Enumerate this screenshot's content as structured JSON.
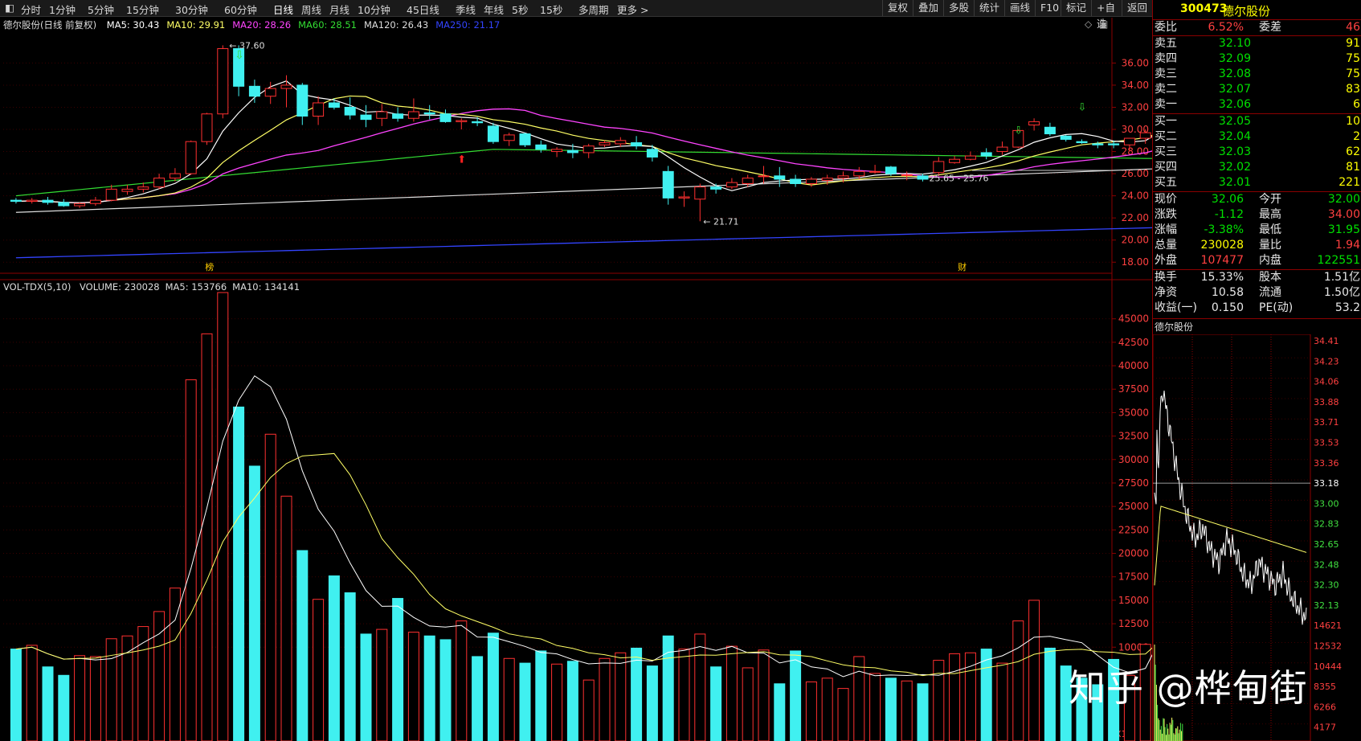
{
  "toolbar": {
    "periods": [
      "分时",
      "1分钟",
      "5分钟",
      "15分钟",
      "30分钟",
      "60分钟",
      "日线",
      "周线",
      "月线",
      "10分钟",
      "45日线",
      "季线",
      "年线",
      "5秒",
      "15秒",
      "多周期",
      "更多 >"
    ],
    "active": "日线",
    "right_buttons": [
      "复权",
      "叠加",
      "多股",
      "统计",
      "画线",
      "F10",
      "标记",
      "+自选",
      "返回"
    ]
  },
  "kline_legend": {
    "name": "德尔股份(日线 前复权)",
    "items": [
      {
        "label": "MA5: 30.43",
        "color": "#ffffff"
      },
      {
        "label": "MA10: 29.91",
        "color": "#ffff66"
      },
      {
        "label": "MA20: 28.26",
        "color": "#ff44ff"
      },
      {
        "label": "MA60: 28.51",
        "color": "#33dd33"
      },
      {
        "label": "MA120: 26.43",
        "color": "#dddddd"
      },
      {
        "label": "MA250: 21.17",
        "color": "#3344ff"
      }
    ]
  },
  "price_axis": [
    "36.00",
    "34.00",
    "32.00",
    "30.00",
    "28.00",
    "26.00",
    "24.00",
    "22.00",
    "20.00",
    "18.00"
  ],
  "annotations": {
    "high": "37.60",
    "low": "21.71",
    "range": "25.65 - 25.76",
    "event1": "榜",
    "event2": "财"
  },
  "vol_legend": {
    "name": "VOL-TDX(5,10)",
    "items": [
      {
        "label": "VOLUME: 230028",
        "color": "#dddddd"
      },
      {
        "label": "MA5: 153766",
        "color": "#dddddd"
      },
      {
        "label": "MA10: 134141",
        "color": "#dddddd"
      }
    ]
  },
  "vol_axis": [
    "45000",
    "42500",
    "40000",
    "37500",
    "35000",
    "32500",
    "30000",
    "27500",
    "25000",
    "22500",
    "20000",
    "17500",
    "15000",
    "12500",
    "10000"
  ],
  "vol_axis_unit": "X10",
  "chart_data": {
    "type": "candlestick",
    "ylim": [
      17,
      38.5
    ],
    "candles": [
      [
        23.6,
        23.8,
        23.3,
        23.5
      ],
      [
        23.5,
        23.8,
        23.3,
        23.6
      ],
      [
        23.6,
        23.9,
        23.2,
        23.4
      ],
      [
        23.4,
        23.7,
        23.0,
        23.1
      ],
      [
        23.1,
        23.4,
        22.9,
        23.3
      ],
      [
        23.3,
        23.9,
        23.1,
        23.6
      ],
      [
        23.6,
        25.0,
        23.5,
        24.6
      ],
      [
        24.4,
        25.0,
        24.1,
        24.6
      ],
      [
        24.6,
        25.2,
        24.3,
        24.8
      ],
      [
        24.8,
        26.0,
        24.6,
        25.6
      ],
      [
        25.6,
        26.5,
        25.3,
        26.0
      ],
      [
        26.0,
        29.0,
        25.9,
        28.9
      ],
      [
        28.9,
        31.5,
        28.6,
        31.4
      ],
      [
        31.4,
        37.6,
        31.0,
        37.3
      ],
      [
        37.3,
        37.6,
        33.0,
        33.9
      ],
      [
        33.9,
        34.5,
        32.4,
        33.0
      ],
      [
        33.0,
        34.3,
        32.3,
        33.7
      ],
      [
        33.7,
        34.9,
        32.0,
        34.0
      ],
      [
        34.0,
        34.2,
        30.4,
        31.2
      ],
      [
        31.2,
        33.0,
        30.4,
        32.4
      ],
      [
        32.4,
        32.8,
        31.8,
        32.0
      ],
      [
        32.0,
        32.9,
        30.9,
        31.3
      ],
      [
        31.3,
        32.2,
        30.2,
        30.9
      ],
      [
        31.0,
        32.3,
        30.3,
        31.6
      ],
      [
        31.4,
        32.0,
        30.7,
        31.0
      ],
      [
        31.0,
        32.8,
        30.7,
        31.6
      ],
      [
        31.5,
        32.2,
        30.9,
        31.4
      ],
      [
        31.4,
        31.8,
        30.6,
        30.7
      ],
      [
        30.7,
        31.0,
        30.0,
        30.8
      ],
      [
        30.7,
        31.1,
        30.3,
        30.6
      ],
      [
        30.3,
        30.6,
        28.7,
        28.9
      ],
      [
        29.0,
        29.7,
        28.5,
        29.5
      ],
      [
        29.6,
        29.7,
        28.4,
        28.6
      ],
      [
        28.6,
        29.0,
        27.9,
        28.2
      ],
      [
        28.0,
        28.4,
        27.5,
        28.2
      ],
      [
        28.1,
        28.7,
        27.4,
        27.9
      ],
      [
        27.9,
        28.7,
        27.4,
        28.5
      ],
      [
        28.6,
        29.0,
        28.4,
        28.8
      ],
      [
        28.7,
        29.3,
        28.4,
        29.0
      ],
      [
        28.8,
        29.4,
        28.2,
        28.5
      ],
      [
        28.2,
        28.6,
        27.1,
        27.5
      ],
      [
        26.2,
        26.7,
        23.2,
        23.8
      ],
      [
        23.8,
        24.4,
        23.0,
        23.9
      ],
      [
        23.7,
        25.1,
        21.7,
        24.8
      ],
      [
        24.8,
        25.1,
        24.2,
        24.6
      ],
      [
        24.8,
        25.6,
        24.6,
        25.2
      ],
      [
        25.1,
        25.9,
        24.8,
        25.6
      ],
      [
        25.8,
        26.7,
        25.1,
        25.8
      ],
      [
        25.8,
        26.6,
        24.8,
        25.5
      ],
      [
        25.5,
        25.9,
        24.8,
        25.1
      ],
      [
        25.1,
        25.7,
        24.8,
        25.5
      ],
      [
        25.4,
        25.9,
        25.0,
        25.6
      ],
      [
        25.6,
        26.2,
        25.2,
        25.8
      ],
      [
        25.8,
        26.6,
        25.5,
        26.2
      ],
      [
        26.2,
        26.8,
        26.0,
        26.2
      ],
      [
        26.6,
        26.7,
        25.8,
        26.0
      ],
      [
        25.9,
        26.2,
        25.4,
        25.9
      ],
      [
        25.8,
        26.0,
        25.3,
        25.5
      ],
      [
        26.1,
        27.5,
        25.8,
        27.1
      ],
      [
        27.0,
        27.6,
        26.9,
        27.3
      ],
      [
        27.3,
        28.0,
        27.2,
        27.6
      ],
      [
        27.9,
        28.3,
        27.3,
        27.6
      ],
      [
        28.0,
        28.9,
        27.7,
        28.4
      ],
      [
        28.4,
        30.0,
        28.3,
        29.9
      ],
      [
        30.4,
        31.0,
        29.9,
        30.7
      ],
      [
        30.2,
        30.6,
        29.4,
        29.6
      ],
      [
        29.4,
        29.5,
        28.9,
        29.1
      ],
      [
        28.9,
        29.1,
        28.7,
        28.8
      ],
      [
        28.7,
        28.9,
        28.3,
        28.6
      ],
      [
        28.7,
        29.0,
        28.3,
        28.6
      ],
      [
        28.6,
        29.0,
        28.1,
        29.2
      ],
      [
        29.2,
        30.0,
        28.7,
        29.7
      ],
      [
        29.7,
        35.6,
        29.6,
        33.2
      ],
      [
        33.2,
        34.0,
        31.9,
        32.1
      ]
    ],
    "volume": [
      9800,
      10200,
      7900,
      7000,
      9100,
      9000,
      10900,
      11200,
      12200,
      13800,
      16300,
      38500,
      43400,
      47800,
      35600,
      29300,
      32700,
      26100,
      20300,
      15100,
      17600,
      15800,
      11400,
      11900,
      15200,
      11600,
      11200,
      10800,
      12800,
      9000,
      11500,
      8800,
      8300,
      9600,
      8200,
      8500,
      6500,
      8800,
      9400,
      9900,
      8000,
      11200,
      9800,
      11400,
      7900,
      10100,
      7800,
      9700,
      6100,
      9600,
      6300,
      6700,
      5600,
      9000,
      7200,
      6700,
      6400,
      6100,
      8600,
      9300,
      9400,
      9800,
      8300,
      12800,
      15000,
      9900,
      8000,
      6700,
      6000,
      8700,
      7000,
      10300,
      23600,
      20100
    ],
    "vol_ylim": [
      0,
      47800
    ]
  },
  "right_panel": {
    "code": "300473",
    "name": "德尔股份",
    "weibi": {
      "label": "委比",
      "value": "6.52%",
      "label2": "委差",
      "value2": "46"
    },
    "sells": [
      {
        "label": "卖五",
        "price": "32.10",
        "vol": "91"
      },
      {
        "label": "卖四",
        "price": "32.09",
        "vol": "75"
      },
      {
        "label": "卖三",
        "price": "32.08",
        "vol": "75"
      },
      {
        "label": "卖二",
        "price": "32.07",
        "vol": "83"
      },
      {
        "label": "卖一",
        "price": "32.06",
        "vol": "6"
      }
    ],
    "buys": [
      {
        "label": "买一",
        "price": "32.05",
        "vol": "10"
      },
      {
        "label": "买二",
        "price": "32.04",
        "vol": "2"
      },
      {
        "label": "买三",
        "price": "32.03",
        "vol": "62"
      },
      {
        "label": "买四",
        "price": "32.02",
        "vol": "81"
      },
      {
        "label": "买五",
        "price": "32.01",
        "vol": "221"
      }
    ],
    "stats": [
      {
        "l1": "现价",
        "v1": "32.06",
        "c1": "green",
        "l2": "今开",
        "v2": "32.00",
        "c2": "green"
      },
      {
        "l1": "涨跌",
        "v1": "-1.12",
        "c1": "green",
        "l2": "最高",
        "v2": "34.00",
        "c2": "red"
      },
      {
        "l1": "涨幅",
        "v1": "-3.38%",
        "c1": "green",
        "l2": "最低",
        "v2": "31.95",
        "c2": "green"
      },
      {
        "l1": "总量",
        "v1": "230028",
        "c1": "yellow",
        "l2": "量比",
        "v2": "1.94",
        "c2": "red"
      },
      {
        "l1": "外盘",
        "v1": "107477",
        "c1": "red",
        "l2": "内盘",
        "v2": "122551",
        "c2": "green"
      }
    ],
    "stats2": [
      {
        "l1": "换手",
        "v1": "15.33%",
        "l2": "股本",
        "v2": "1.51亿"
      },
      {
        "l1": "净资",
        "v1": "10.58",
        "l2": "流通",
        "v2": "1.50亿"
      },
      {
        "l1": "收益(一)",
        "v1": "0.150",
        "l2": "PE(动)",
        "v2": "53.2"
      }
    ],
    "mini_title": "德尔股份",
    "mini_axis": [
      "34.41",
      "34.23",
      "34.06",
      "33.88",
      "33.71",
      "33.53",
      "33.36",
      "33.18",
      "33.00",
      "32.83",
      "32.65",
      "32.48",
      "32.30",
      "32.13",
      "14621",
      "12532",
      "10444",
      "8355",
      "6266",
      "4177"
    ],
    "mini_highlight": "33.18"
  },
  "watermark": "知乎 @桦甸街"
}
